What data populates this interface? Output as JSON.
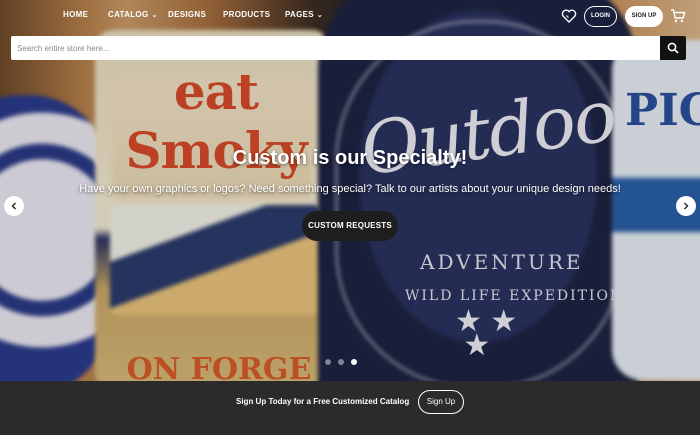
{
  "nav": {
    "items": [
      {
        "label": "HOME",
        "has_dropdown": false
      },
      {
        "label": "CATALOG",
        "has_dropdown": true
      },
      {
        "label": "DESIGNS",
        "has_dropdown": false
      },
      {
        "label": "PRODUCTS",
        "has_dropdown": false
      },
      {
        "label": "PAGES",
        "has_dropdown": true
      }
    ],
    "login_label": "LOGIN",
    "signup_label": "SIGN UP",
    "icons": [
      "heart-icon",
      "cart-icon"
    ]
  },
  "search": {
    "placeholder": "Search entire store here...",
    "value": ""
  },
  "hero": {
    "title": "Custom is our Specialty!",
    "subtitle": "Have your own graphics or logos? Need something special? Talk to our artists about your unique design needs!",
    "cta_label": "CUSTOM REQUESTS",
    "slide_count": 3,
    "active_slide": 3,
    "photo_text": {
      "left_label": "eat Smoky",
      "left_bottom": "ON FORGE",
      "center_script": "Outdoor",
      "center_line1": "ADVENTURE",
      "center_line2": "WILD LIFE EXPEDITION",
      "right_label": "PIG"
    }
  },
  "promo": {
    "text": "Sign Up Today for a Free Customized Catalog",
    "button_label": "Sign Up"
  },
  "colors": {
    "footer_bg": "#2b2b2b",
    "cta_bg": "#1e1e1e",
    "search_button_bg": "#111111",
    "text_light": "#ffffff"
  }
}
